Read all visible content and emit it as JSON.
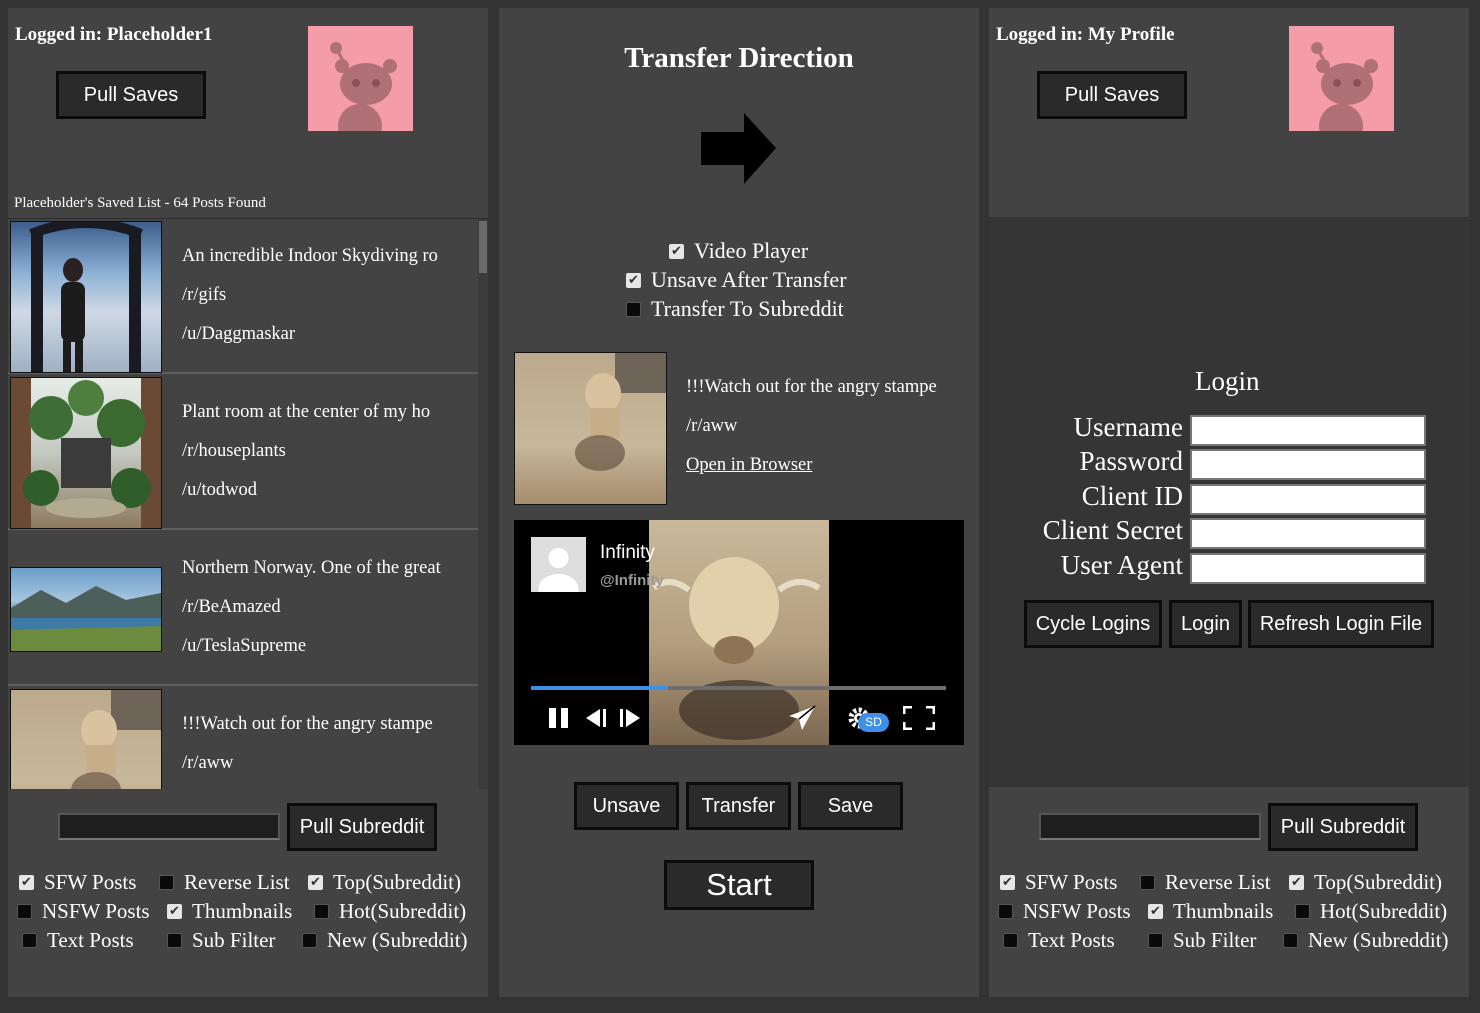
{
  "left": {
    "logged_in": "Logged in: Placeholder1",
    "pull_saves": "Pull Saves",
    "saved_list_title": "Placeholder's Saved List - 64 Posts Found",
    "posts": [
      {
        "title": "An incredible Indoor Skydiving ro",
        "subreddit": "/r/gifs",
        "user": "/u/Daggmaskar"
      },
      {
        "title": "Plant room at the center of my ho",
        "subreddit": "/r/houseplants",
        "user": "/u/todwod"
      },
      {
        "title": "Northern Norway. One of the great",
        "subreddit": "/r/BeAmazed",
        "user": "/u/TeslaSupreme"
      },
      {
        "title": "!!!Watch out for the angry stampe",
        "subreddit": "/r/aww",
        "user": ""
      }
    ],
    "subreddit_input": "",
    "pull_subreddit": "Pull Subreddit",
    "checkboxes": {
      "sfw": {
        "label": "SFW Posts",
        "checked": true
      },
      "nsfw": {
        "label": "NSFW Posts",
        "checked": false
      },
      "text": {
        "label": "Text Posts",
        "checked": false
      },
      "reverse": {
        "label": "Reverse List",
        "checked": false
      },
      "thumbnails": {
        "label": "Thumbnails",
        "checked": true
      },
      "subfilter": {
        "label": "Sub Filter",
        "checked": false
      },
      "top": {
        "label": "Top(Subreddit)",
        "checked": true
      },
      "hot": {
        "label": "Hot(Subreddit)",
        "checked": false
      },
      "new": {
        "label": "New (Subreddit)",
        "checked": false
      }
    }
  },
  "center": {
    "title": "Transfer Direction",
    "direction": "right",
    "options": {
      "video_player": {
        "label": "Video Player",
        "checked": true
      },
      "unsave_after": {
        "label": "Unsave After Transfer",
        "checked": true
      },
      "to_subreddit": {
        "label": "Transfer To Subreddit",
        "checked": false
      }
    },
    "selected_post": {
      "title": "!!!Watch out for the angry stampe",
      "subreddit": "/r/aww",
      "open_link": "Open in Browser"
    },
    "video": {
      "channel_name": "Infinity",
      "channel_handle": "@Infinity",
      "quality_badge": "SD",
      "progress": 0.33
    },
    "buttons": {
      "unsave": "Unsave",
      "transfer": "Transfer",
      "save": "Save",
      "start": "Start"
    }
  },
  "right": {
    "logged_in": "Logged in: My Profile",
    "pull_saves": "Pull Saves",
    "login": {
      "heading": "Login",
      "username": "Username",
      "password": "Password",
      "client_id": "Client ID",
      "client_secret": "Client Secret",
      "user_agent": "User Agent"
    },
    "buttons": {
      "cycle": "Cycle Logins",
      "login": "Login",
      "refresh": "Refresh Login File"
    },
    "subreddit_input": "",
    "pull_subreddit": "Pull Subreddit",
    "checkboxes": {
      "sfw": {
        "label": "SFW Posts",
        "checked": true
      },
      "nsfw": {
        "label": "NSFW Posts",
        "checked": false
      },
      "text": {
        "label": "Text Posts",
        "checked": false
      },
      "reverse": {
        "label": "Reverse List",
        "checked": false
      },
      "thumbnails": {
        "label": "Thumbnails",
        "checked": true
      },
      "subfilter": {
        "label": "Sub Filter",
        "checked": false
      },
      "top": {
        "label": "Top(Subreddit)",
        "checked": true
      },
      "hot": {
        "label": "Hot(Subreddit)",
        "checked": false
      },
      "new": {
        "label": "New (Subreddit)",
        "checked": false
      }
    }
  },
  "colors": {
    "background": "#333333",
    "panel": "#434343",
    "avatar": "#f49ca8",
    "progress": "#3d8fe8"
  },
  "icons": [
    "reddit-snoo-icon",
    "arrow-right-icon",
    "pause-icon",
    "prev-frame-icon",
    "next-frame-icon",
    "share-icon",
    "settings-icon",
    "fullscreen-icon",
    "user-avatar-icon"
  ]
}
